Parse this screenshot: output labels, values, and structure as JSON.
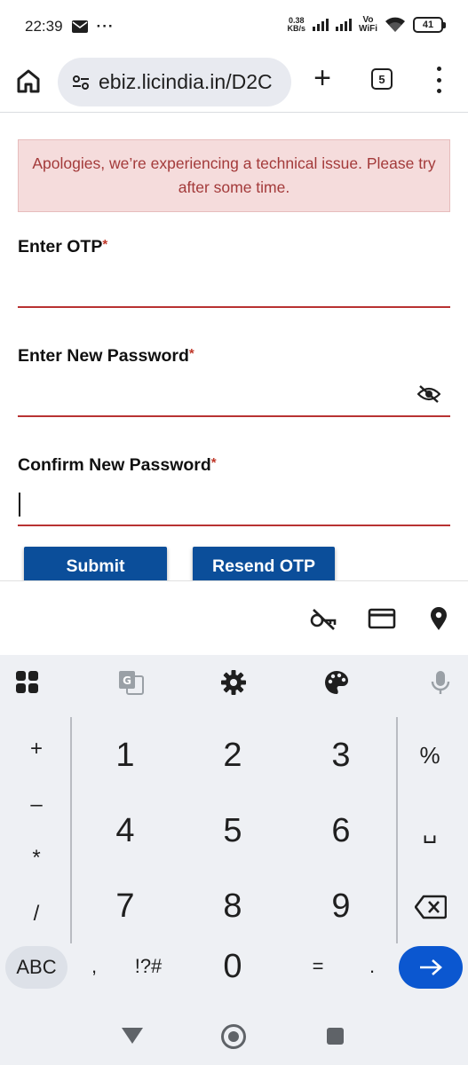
{
  "status_bar": {
    "time": "22:39",
    "net_speed_value": "0.38",
    "net_speed_unit": "KB/s",
    "vowifi_top": "Vo",
    "vowifi_bottom": "WiFi",
    "battery": "41"
  },
  "browser": {
    "url": "ebiz.licindia.in/D2C",
    "tab_count": "5"
  },
  "page": {
    "alert_text": "Apologies, we’re experiencing a technical issue. Please try after some time.",
    "fields": [
      {
        "label": "Enter OTP",
        "required_mark": "*"
      },
      {
        "label": "Enter New Password",
        "required_mark": "*"
      },
      {
        "label": "Confirm New Password",
        "required_mark": "*"
      }
    ],
    "submit_label": "Submit",
    "resend_label": "Resend OTP"
  },
  "keyboard": {
    "symbols": [
      "+",
      "–",
      "*",
      "/"
    ],
    "rows": [
      [
        "1",
        "2",
        "3"
      ],
      [
        "4",
        "5",
        "6"
      ],
      [
        "7",
        "8",
        "9"
      ]
    ],
    "right_keys": [
      "%",
      "␣"
    ],
    "abc_label": "ABC",
    "comma": ",",
    "symbols_label": "!?#",
    "zero": "0",
    "equals": "=",
    "period": "."
  },
  "colors": {
    "accent_red": "#b83232",
    "button_blue": "#0b4e9a",
    "alert_bg": "#f5dcdc",
    "enter_blue": "#0b57d0"
  }
}
